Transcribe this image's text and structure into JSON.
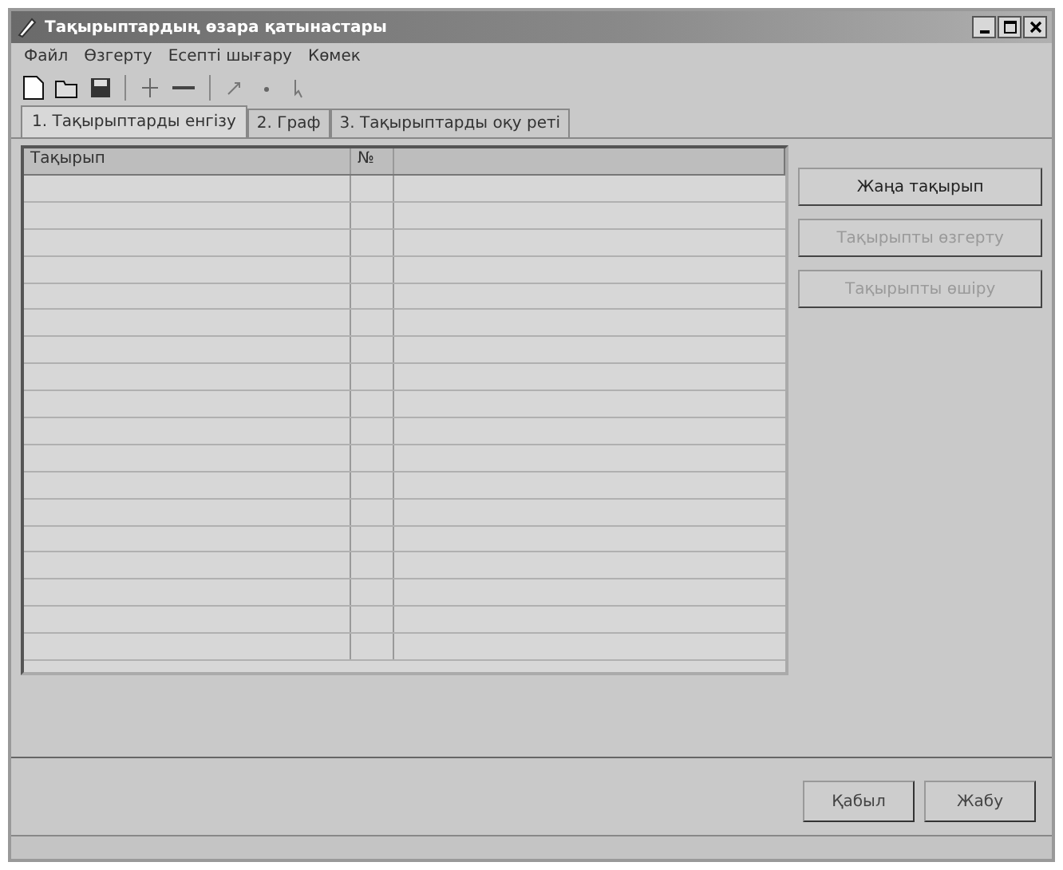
{
  "window": {
    "title": "Тақырыптардың өзара қатынастары"
  },
  "menu": [
    "Файл",
    "Өзгерту",
    "Есепті шығару",
    "Көмек"
  ],
  "tabs": [
    {
      "label": "1. Тақырыптарды енгізу",
      "selected": true
    },
    {
      "label": "2. Граф",
      "selected": false
    },
    {
      "label": "3. Тақырыптарды оқу реті",
      "selected": false
    }
  ],
  "table": {
    "columns": [
      "Тақырып",
      "№"
    ]
  },
  "side_buttons": [
    {
      "label": "Жаңа тақырып",
      "disabled": false
    },
    {
      "label": "Тақырыпты өзгерту",
      "disabled": true
    },
    {
      "label": "Тақырыпты өшіру",
      "disabled": true
    }
  ],
  "footer_buttons": [
    "Қабыл",
    "Жабу"
  ]
}
